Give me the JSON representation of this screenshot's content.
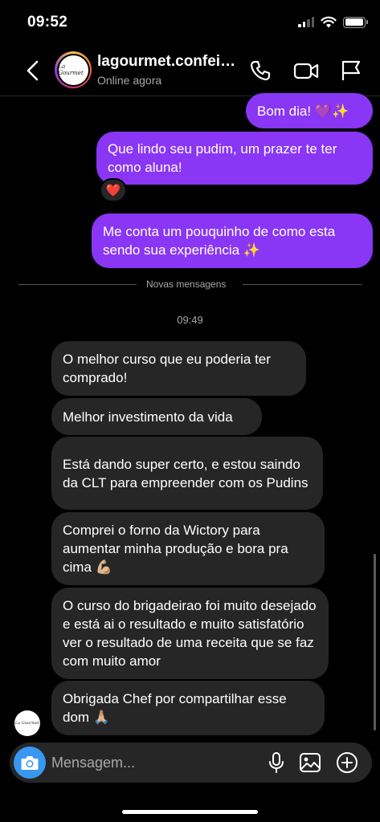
{
  "status_bar": {
    "time": "09:52"
  },
  "header": {
    "name": "lagourmet.confeitaria",
    "status": "Online agora",
    "avatar_logo_text": "La Gourmet"
  },
  "messages": {
    "outgoing": [
      {
        "text": "Bom dia! 💜✨"
      },
      {
        "text": "Que lindo seu pudim, um prazer te ter como aluna!",
        "reaction": "❤️"
      },
      {
        "text": "Me conta um pouquinho de como esta sendo sua experiência ✨"
      }
    ],
    "divider_label": "Novas mensagens",
    "time_label": "09:49",
    "incoming": [
      {
        "text": "O melhor curso que eu poderia ter comprado!"
      },
      {
        "text": "Melhor investimento da vida"
      },
      {
        "text": "Está dando super certo, e estou saindo da CLT para empreender com os Pudins"
      },
      {
        "text": "Comprei o forno da Wictory para aumentar minha produção e bora pra cima 💪🏼"
      },
      {
        "text": "O curso do brigadeirao foi muito desejado e está ai o resultado e muito satisfatório ver o resultado de uma receita que se faz com muito amor"
      },
      {
        "text": "Obrigada Chef por compartilhar esse dom 🙏🏼"
      }
    ]
  },
  "composer": {
    "placeholder": "Mensagem..."
  },
  "colors": {
    "outgoing_bubble": "#8a36f5",
    "incoming_bubble": "#262626",
    "camera_button": "#3897f0",
    "background": "#000000"
  }
}
